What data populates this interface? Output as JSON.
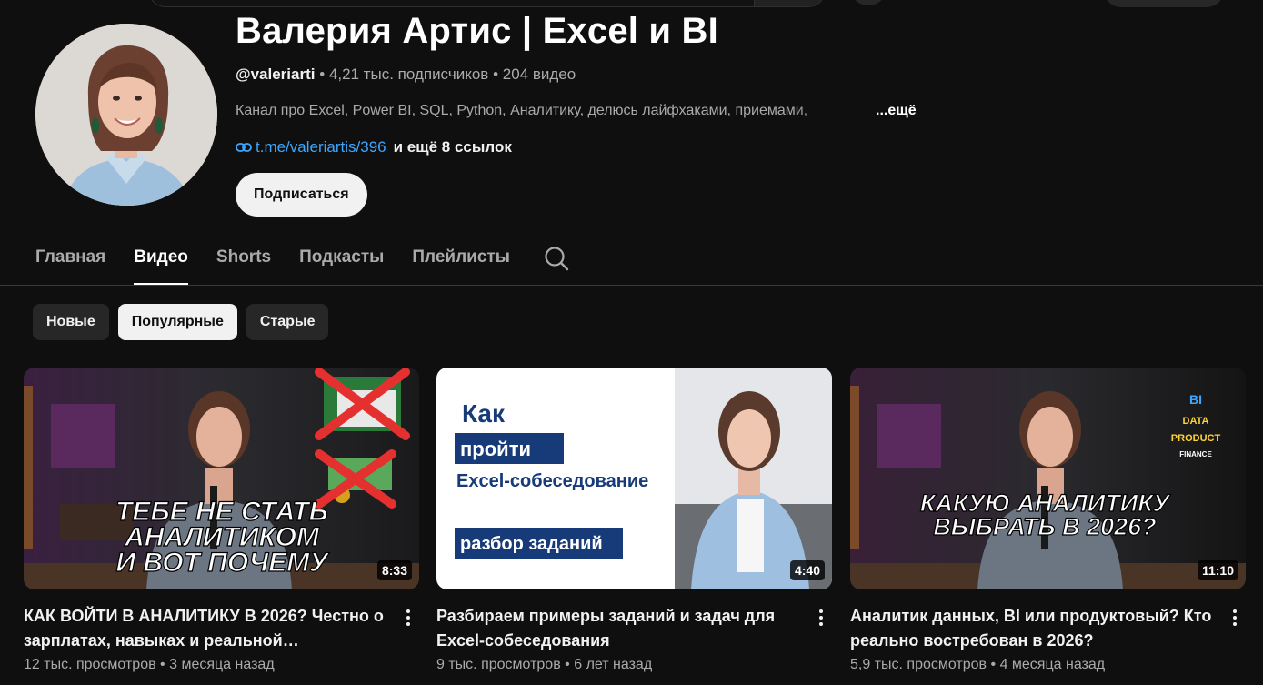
{
  "header": {
    "channel_name": "Валерия Артис | Excel и BI",
    "handle": "@valeriarti",
    "subscribers": "4,21 тыс. подписчиков",
    "video_count": "204 видео",
    "separator": "•",
    "description": "Канал про Excel, Power BI, SQL, Python, Аналитику, делюсь лайфхаками, приемами,",
    "more_label": "...ещё",
    "link_text": "t.me/valeriartis/396",
    "link_more": "и ещё 8 ссылок",
    "subscribe_label": "Подписаться"
  },
  "tabs": [
    {
      "label": "Главная",
      "active": false
    },
    {
      "label": "Видео",
      "active": true
    },
    {
      "label": "Shorts",
      "active": false
    },
    {
      "label": "Подкасты",
      "active": false
    },
    {
      "label": "Плейлисты",
      "active": false
    }
  ],
  "chips": [
    {
      "label": "Новые",
      "active": false
    },
    {
      "label": "Популярные",
      "active": true
    },
    {
      "label": "Старые",
      "active": false
    }
  ],
  "videos": [
    {
      "title": "КАК ВОЙТИ В АНАЛИТИКУ В 2026? Честно о зарплатах, навыках и реальной…",
      "views": "12 тыс. просмотров",
      "age": "3 месяца назад",
      "duration": "8:33",
      "thumb_text": [
        "ТЕБЕ НЕ СТАТЬ",
        "АНАЛИТИКОМ",
        "И ВОТ ПОЧЕМУ"
      ]
    },
    {
      "title": "Разбираем примеры заданий и задач для Excel-собеседования",
      "views": "9 тыс. просмотров",
      "age": "6 лет назад",
      "duration": "4:40",
      "thumb_text": [
        "Как",
        "пройти",
        "Excel-собеседование",
        "разбор заданий"
      ]
    },
    {
      "title": "Аналитик данных, BI или продуктовый? Кто реально востребован в 2026?",
      "views": "5,9 тыс. просмотров",
      "age": "4 месяца назад",
      "duration": "11:10",
      "thumb_text": [
        "КАКУЮ АНАЛИТИКУ",
        "ВЫБРАТЬ В 2026?",
        "BI",
        "DATA",
        "PRODUCT",
        "FINANCE"
      ]
    }
  ],
  "icons": {
    "link": "link-icon",
    "search": "search-icon",
    "more": "more-vert-icon"
  },
  "colors": {
    "background": "#0f0f0f",
    "link": "#3ea6ff",
    "chip": "#272727",
    "chip_active": "#f1f1f1",
    "secondary_text": "#aaaaaa"
  }
}
